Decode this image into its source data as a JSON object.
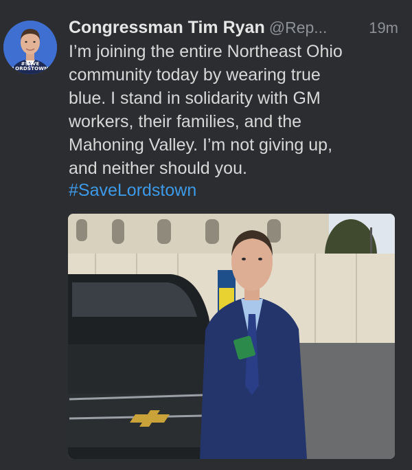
{
  "tweet": {
    "avatar": {
      "icon": "profile-photo",
      "tag_line1": "#SAVE",
      "tag_line2": "LORDSTOWN"
    },
    "display_name": "Congressman Tim Ryan",
    "handle": "@Rep...",
    "time": "19m",
    "body": "I’m joining the entire Northeast Ohio\ncommunity today by wearing true\nblue. I stand in solidarity with GM\nworkers, their families, and the\nMahoning Valley. I’m not giving up,\nand neither should you.",
    "hashtag": "#SaveLordstown",
    "photo": {
      "icon": "attached-photo"
    }
  },
  "colors": {
    "background": "#2b2d30",
    "name": "#e6e6e6",
    "meta": "#8e9196",
    "text": "#d8d8d8",
    "link": "#3d9ae8"
  }
}
